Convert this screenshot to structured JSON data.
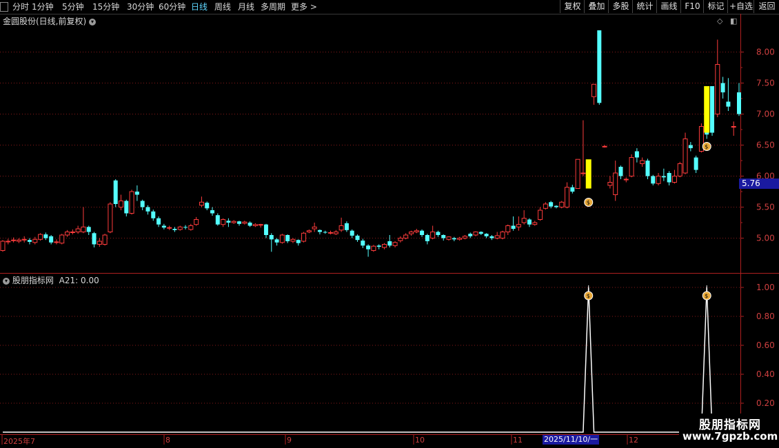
{
  "toolbar": {
    "left_items": [
      {
        "label": "分时",
        "active": false
      },
      {
        "label": "1分钟",
        "active": false
      },
      {
        "label": "5分钟",
        "active": false
      },
      {
        "label": "15分钟",
        "active": false
      },
      {
        "label": "30分钟",
        "active": false
      },
      {
        "label": "60分钟",
        "active": false
      },
      {
        "label": "日线",
        "active": true
      },
      {
        "label": "周线",
        "active": false
      },
      {
        "label": "月线",
        "active": false
      },
      {
        "label": "多周期",
        "active": false
      },
      {
        "label": "更多 >",
        "active": false
      }
    ],
    "right_items": [
      "复权",
      "叠加",
      "多股",
      "统计",
      "画线",
      "F10",
      "标记",
      "+自选",
      "返回"
    ]
  },
  "main_chart": {
    "title": "金圆股份(日线,前复权)",
    "price_axis": [
      "8.00",
      "7.50",
      "7.00",
      "6.50",
      "6.00",
      "5.50",
      "5.00"
    ],
    "current_price": "5.76",
    "colors": {
      "up": "#ff3c3c",
      "down": "#54ffff",
      "signal_bar": "#ffff00",
      "grid": "#8b1a1a"
    }
  },
  "indicator": {
    "name": "股朋指标网",
    "value_label": "A21: 0.00",
    "axis": [
      "1.00",
      "0.80",
      "0.60",
      "0.40",
      "0.20"
    ]
  },
  "date_axis": {
    "labels": [
      "2025年7",
      "8",
      "9",
      "10",
      "11",
      "12"
    ],
    "cursor_date": "2025/11/10/一"
  },
  "watermark": {
    "line1": "股朋指标网",
    "line2": "www.7gpzb.com"
  },
  "chart_data": {
    "type": "candlestick",
    "title": "金圆股份(日线,前复权)",
    "ylim": [
      4.55,
      8.35
    ],
    "candles": [
      [
        4.8,
        4.95,
        4.78,
        4.97
      ],
      [
        4.95,
        4.95,
        4.9,
        4.99
      ],
      [
        4.97,
        4.97,
        4.93,
        5.01
      ],
      [
        4.95,
        4.97,
        4.92,
        5.0
      ],
      [
        4.98,
        4.98,
        4.93,
        5.03
      ],
      [
        4.97,
        4.94,
        4.9,
        5.0
      ],
      [
        4.93,
        4.98,
        4.9,
        5.02
      ],
      [
        4.98,
        5.06,
        4.96,
        5.08
      ],
      [
        5.06,
        5.0,
        4.97,
        5.09
      ],
      [
        5.03,
        4.93,
        4.9,
        5.05
      ],
      [
        4.93,
        4.94,
        4.9,
        4.98
      ],
      [
        4.92,
        5.05,
        4.9,
        5.07
      ],
      [
        5.05,
        5.1,
        5.02,
        5.13
      ],
      [
        5.1,
        5.1,
        5.06,
        5.14
      ],
      [
        5.1,
        5.15,
        5.07,
        5.2
      ],
      [
        5.1,
        5.18,
        5.08,
        5.5
      ],
      [
        5.18,
        5.1,
        5.05,
        5.2
      ],
      [
        5.08,
        4.9,
        4.85,
        5.1
      ],
      [
        4.9,
        4.95,
        4.86,
        5.0
      ],
      [
        4.9,
        5.05,
        4.88,
        5.07
      ],
      [
        5.1,
        5.55,
        5.08,
        5.58
      ],
      [
        5.93,
        5.55,
        5.5,
        5.95
      ],
      [
        5.5,
        5.6,
        5.45,
        5.7
      ],
      [
        5.6,
        5.4,
        5.35,
        5.62
      ],
      [
        5.4,
        5.75,
        5.38,
        5.78
      ],
      [
        5.75,
        5.7,
        5.6,
        5.85
      ],
      [
        5.6,
        5.5,
        5.45,
        5.62
      ],
      [
        5.5,
        5.43,
        5.38,
        5.53
      ],
      [
        5.43,
        5.32,
        5.28,
        5.46
      ],
      [
        5.32,
        5.22,
        5.18,
        5.35
      ],
      [
        5.2,
        5.17,
        5.14,
        5.23
      ],
      [
        5.17,
        5.17,
        5.13,
        5.2
      ],
      [
        5.15,
        5.13,
        5.1,
        5.18
      ],
      [
        5.14,
        5.18,
        5.12,
        5.2
      ],
      [
        5.18,
        5.17,
        5.14,
        5.21
      ],
      [
        5.14,
        5.2,
        5.12,
        5.23
      ],
      [
        5.22,
        5.3,
        5.2,
        5.34
      ],
      [
        5.53,
        5.58,
        5.5,
        5.67
      ],
      [
        5.57,
        5.48,
        5.45,
        5.59
      ],
      [
        5.45,
        5.4,
        5.36,
        5.5
      ],
      [
        5.37,
        5.22,
        5.2,
        5.4
      ],
      [
        5.22,
        5.3,
        5.18,
        5.32
      ],
      [
        5.28,
        5.25,
        5.18,
        5.32
      ],
      [
        5.25,
        5.27,
        5.23,
        5.29
      ],
      [
        5.27,
        5.23,
        5.2,
        5.28
      ],
      [
        5.24,
        5.26,
        5.22,
        5.28
      ],
      [
        5.25,
        5.2,
        5.18,
        5.27
      ],
      [
        5.2,
        5.22,
        5.18,
        5.24
      ],
      [
        5.21,
        5.22,
        5.17,
        5.23
      ],
      [
        5.22,
        5.05,
        5.0,
        5.23
      ],
      [
        5.05,
        4.98,
        4.78,
        5.08
      ],
      [
        4.98,
        4.93,
        4.88,
        5.0
      ],
      [
        4.93,
        5.05,
        4.91,
        5.07
      ],
      [
        5.05,
        4.95,
        4.92,
        5.06
      ],
      [
        4.95,
        4.98,
        4.92,
        5.0
      ],
      [
        4.97,
        4.92,
        4.88,
        4.98
      ],
      [
        4.95,
        5.08,
        4.93,
        5.1
      ],
      [
        5.1,
        5.12,
        5.08,
        5.14
      ],
      [
        5.15,
        5.18,
        5.1,
        5.25
      ],
      [
        5.13,
        5.1,
        5.06,
        5.14
      ],
      [
        5.1,
        5.09,
        5.07,
        5.12
      ],
      [
        5.09,
        5.09,
        5.06,
        5.12
      ],
      [
        5.07,
        5.1,
        5.05,
        5.13
      ],
      [
        5.13,
        5.2,
        5.1,
        5.33
      ],
      [
        5.24,
        5.13,
        5.1,
        5.27
      ],
      [
        5.12,
        5.04,
        5.0,
        5.14
      ],
      [
        5.04,
        4.97,
        4.94,
        5.06
      ],
      [
        4.96,
        4.88,
        4.84,
        4.99
      ],
      [
        4.88,
        4.82,
        4.7,
        4.9
      ],
      [
        4.8,
        4.87,
        4.78,
        4.89
      ],
      [
        4.88,
        4.86,
        4.82,
        4.9
      ],
      [
        4.85,
        4.9,
        4.82,
        4.92
      ],
      [
        4.95,
        4.88,
        4.85,
        5.05
      ],
      [
        4.88,
        4.93,
        4.85,
        4.95
      ],
      [
        4.96,
        5.0,
        4.93,
        5.03
      ],
      [
        5.0,
        5.05,
        4.98,
        5.08
      ],
      [
        5.07,
        5.1,
        5.04,
        5.12
      ],
      [
        5.1,
        5.12,
        5.08,
        5.15
      ],
      [
        5.12,
        5.05,
        5.02,
        5.14
      ],
      [
        5.05,
        4.95,
        4.9,
        5.07
      ],
      [
        5.0,
        5.1,
        4.98,
        5.2
      ],
      [
        5.1,
        5.05,
        5.02,
        5.12
      ],
      [
        5.05,
        5.0,
        4.96,
        5.06
      ],
      [
        4.98,
        5.02,
        4.96,
        5.03
      ],
      [
        5.0,
        4.98,
        4.95,
        5.02
      ],
      [
        4.98,
        5.0,
        4.96,
        5.02
      ],
      [
        5.0,
        5.03,
        4.98,
        5.05
      ],
      [
        5.07,
        5.03,
        5.0,
        5.09
      ],
      [
        5.05,
        5.1,
        5.03,
        5.11
      ],
      [
        5.1,
        5.07,
        5.05,
        5.11
      ],
      [
        5.07,
        5.03,
        5.0,
        5.08
      ],
      [
        5.03,
        5.0,
        4.97,
        5.05
      ],
      [
        5.0,
        5.04,
        4.98,
        5.1
      ],
      [
        5.0,
        5.1,
        4.98,
        5.12
      ],
      [
        5.1,
        5.2,
        5.05,
        5.22
      ],
      [
        5.2,
        5.15,
        5.12,
        5.35
      ],
      [
        5.18,
        5.22,
        5.12,
        5.35
      ],
      [
        5.25,
        5.32,
        5.22,
        5.45
      ],
      [
        5.3,
        5.22,
        5.18,
        5.32
      ],
      [
        5.22,
        5.25,
        5.2,
        5.28
      ],
      [
        5.3,
        5.45,
        5.28,
        5.5
      ],
      [
        5.48,
        5.55,
        5.46,
        5.58
      ],
      [
        5.58,
        5.51,
        5.48,
        5.6
      ],
      [
        5.52,
        5.5,
        5.48,
        5.53
      ],
      [
        5.5,
        5.58,
        5.48,
        5.6
      ],
      [
        5.5,
        5.82,
        5.48,
        5.9
      ],
      [
        5.82,
        5.75,
        5.72,
        5.86
      ],
      [
        5.8,
        6.27,
        5.8,
        6.27
      ],
      [
        6.05,
        6.05,
        6.0,
        6.9
      ],
      [
        6.05,
        6.05,
        6.03,
        6.07
      ],
      [
        7.28,
        7.48,
        7.15,
        7.48
      ],
      [
        8.35,
        7.18,
        7.15,
        8.35
      ],
      [
        6.48,
        6.48,
        6.46,
        6.5
      ],
      [
        5.85,
        5.9,
        5.8,
        6.0
      ],
      [
        5.7,
        6.05,
        5.6,
        6.25
      ],
      [
        6.15,
        6.0,
        5.95,
        6.17
      ],
      [
        5.95,
        5.95,
        5.9,
        5.98
      ],
      [
        6.0,
        6.3,
        5.98,
        6.35
      ],
      [
        6.4,
        6.3,
        6.22,
        6.45
      ],
      [
        6.2,
        6.25,
        6.15,
        6.3
      ],
      [
        6.25,
        6.0,
        5.95,
        6.28
      ],
      [
        6.0,
        5.88,
        5.85,
        6.02
      ],
      [
        5.88,
        6.0,
        5.85,
        6.05
      ],
      [
        6.0,
        5.98,
        5.92,
        6.12
      ],
      [
        6.05,
        5.9,
        5.85,
        6.08
      ],
      [
        5.9,
        6.0,
        5.88,
        6.1
      ],
      [
        6.0,
        6.2,
        5.98,
        6.23
      ],
      [
        6.05,
        6.6,
        6.03,
        6.7
      ],
      [
        6.5,
        6.45,
        6.4,
        6.55
      ],
      [
        6.3,
        6.1,
        6.05,
        6.33
      ],
      [
        6.4,
        6.8,
        6.38,
        6.85
      ],
      [
        6.8,
        6.67,
        6.6,
        6.9
      ],
      [
        7.45,
        6.7,
        6.65,
        7.45
      ],
      [
        7.0,
        7.8,
        6.95,
        8.2
      ],
      [
        7.5,
        7.35,
        7.25,
        7.6
      ],
      [
        7.2,
        7.12,
        7.05,
        7.58
      ],
      [
        6.8,
        6.8,
        6.65,
        6.88
      ],
      [
        7.35,
        7.0,
        6.97,
        7.5
      ]
    ],
    "signal_bars": [
      [
        6.27,
        5.8
      ],
      [
        7.45,
        6.7
      ]
    ]
  }
}
